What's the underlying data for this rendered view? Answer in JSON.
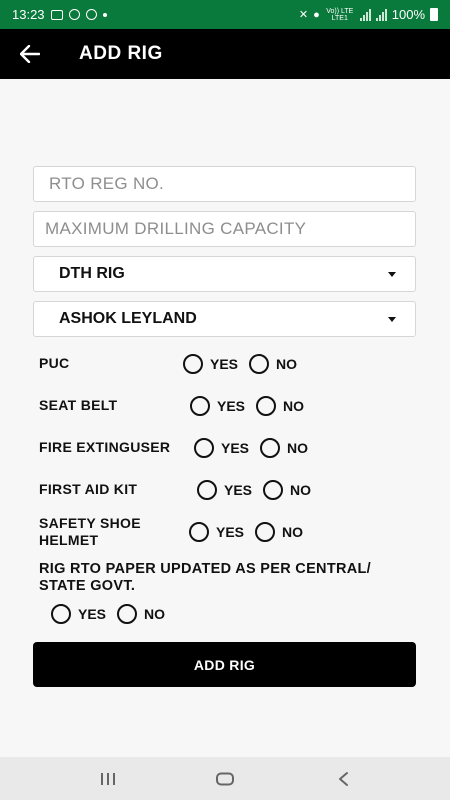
{
  "status_bar": {
    "time": "13:23",
    "network_label": "Vo)) LTE LTE1",
    "battery": "100%"
  },
  "app_bar": {
    "title": "ADD RIG"
  },
  "form": {
    "rto_reg_placeholder": "RTO REG NO.",
    "capacity_placeholder": "MAXIMUM DRILLING CAPACITY",
    "rig_type_value": "DTH RIG",
    "make_value": "ASHOK LEYLAND",
    "yes_label": "YES",
    "no_label": "NO",
    "questions": {
      "puc": "PUC",
      "seat_belt": "SEAT BELT",
      "fire_extinguser": "FIRE EXTINGUSER",
      "first_aid_kit": "FIRST AID KIT",
      "safety_line1": "SAFETY SHOE",
      "safety_line2": "HELMET",
      "rto_paper_line1": "RIG RTO PAPER UPDATED AS PER CENTRAL/",
      "rto_paper_line2": "STATE GOVT."
    },
    "submit_label": "ADD RIG"
  },
  "icons": {
    "back": "arrow-left-icon",
    "dropdown": "caret-down-icon",
    "nav_recents": "recents-icon",
    "nav_home": "home-icon",
    "nav_back": "nav-back-icon"
  }
}
